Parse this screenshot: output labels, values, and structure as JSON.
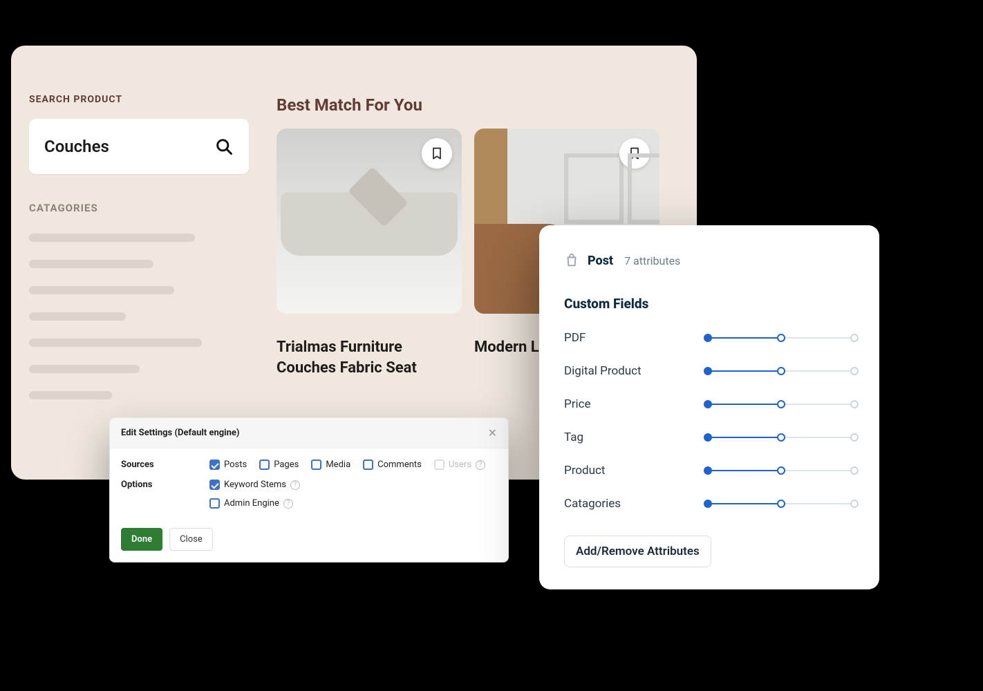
{
  "sidebar": {
    "search_label": "SEARCH PRODUCT",
    "search_value": "Couches",
    "categories_label": "CATAGORIES"
  },
  "results": {
    "heading": "Best Match For You",
    "items": [
      {
        "title": "Trialmas Furniture Couches Fabric Seat"
      },
      {
        "title": "Modern L Couches"
      }
    ]
  },
  "dialog": {
    "title": "Edit Settings (Default engine)",
    "sources_label": "Sources",
    "options_label": "Options",
    "sources": [
      {
        "label": "Posts",
        "checked": true,
        "disabled": false
      },
      {
        "label": "Pages",
        "checked": false,
        "disabled": false
      },
      {
        "label": "Media",
        "checked": false,
        "disabled": false
      },
      {
        "label": "Comments",
        "checked": false,
        "disabled": false
      },
      {
        "label": "Users",
        "checked": false,
        "disabled": true
      }
    ],
    "options": [
      {
        "label": "Keyword Stems",
        "checked": true,
        "help": true
      },
      {
        "label": "Admin Engine",
        "checked": false,
        "help": true
      }
    ],
    "done": "Done",
    "close": "Close"
  },
  "attr": {
    "entity": "Post",
    "count_text": "7 attributes",
    "section": "Custom Fields",
    "fields": [
      {
        "label": "PDF",
        "fill": 50
      },
      {
        "label": "Digital Product",
        "fill": 50
      },
      {
        "label": "Price",
        "fill": 50
      },
      {
        "label": "Tag",
        "fill": 50
      },
      {
        "label": "Product",
        "fill": 50
      },
      {
        "label": "Catagories",
        "fill": 50
      }
    ],
    "button": "Add/Remove Attributes"
  }
}
